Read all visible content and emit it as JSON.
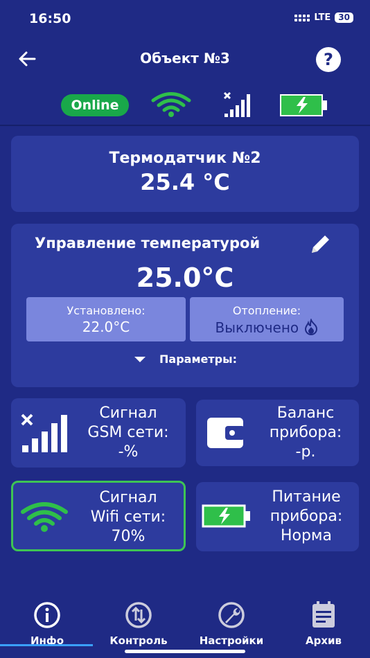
{
  "status_bar": {
    "time": "16:50",
    "network": "LTE",
    "battery": "30"
  },
  "header": {
    "title": "Объект №3",
    "help": "?"
  },
  "status_row": {
    "online": "Online"
  },
  "sensor": {
    "label": "Термодатчик №2",
    "value": "25.4 °C"
  },
  "control": {
    "title": "Управление температурой",
    "current_temp": "25.0°C",
    "set_label": "Установлено:",
    "set_value": "22.0°C",
    "heating_label": "Отопление:",
    "heating_value": "Выключено",
    "params_label": "Параметры:"
  },
  "gsm": {
    "line1": "Сигнал",
    "line2": "GSM сети:",
    "value": "-%"
  },
  "balance": {
    "line1": "Баланс",
    "line2": "прибора:",
    "value": "-р."
  },
  "wifi": {
    "line1": "Сигнал",
    "line2": "Wifi сети:",
    "value": "70%"
  },
  "power": {
    "line1": "Питание",
    "line2": "прибора:",
    "value": "Норма"
  },
  "nav": [
    {
      "label": "Инфо",
      "icon": "info-icon"
    },
    {
      "label": "Контроль",
      "icon": "sync-icon"
    },
    {
      "label": "Настройки",
      "icon": "wrench-icon"
    },
    {
      "label": "Архив",
      "icon": "archive-icon"
    }
  ],
  "colors": {
    "background": "#1f2a85",
    "card": "#2d3b9e",
    "sub_box": "#7a86dd",
    "online": "#19a84a",
    "wifi": "#2fbf4a",
    "nav_active": "#3aa0ff"
  }
}
